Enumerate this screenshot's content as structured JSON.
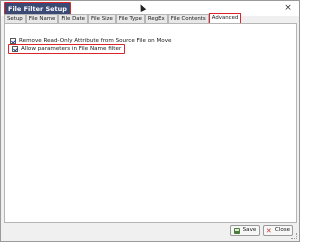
{
  "window": {
    "title": "File Filter Setup"
  },
  "tabs": [
    {
      "label": "Setup"
    },
    {
      "label": "File Name"
    },
    {
      "label": "File Date"
    },
    {
      "label": "File Size"
    },
    {
      "label": "File Type"
    },
    {
      "label": "RegEx"
    },
    {
      "label": "File Contents"
    },
    {
      "label": "Advanced",
      "active": true
    }
  ],
  "options": {
    "remove_readonly": {
      "label": "Remove Read-Only Attribute from Source File on Move",
      "checked": true
    },
    "allow_params": {
      "label": "Allow parameters in File Name filter",
      "checked": true
    }
  },
  "footer": {
    "save_label": "Save",
    "close_label": "Close"
  },
  "colors": {
    "highlight": "#d9262b",
    "title_bg": "#3b4a75"
  }
}
